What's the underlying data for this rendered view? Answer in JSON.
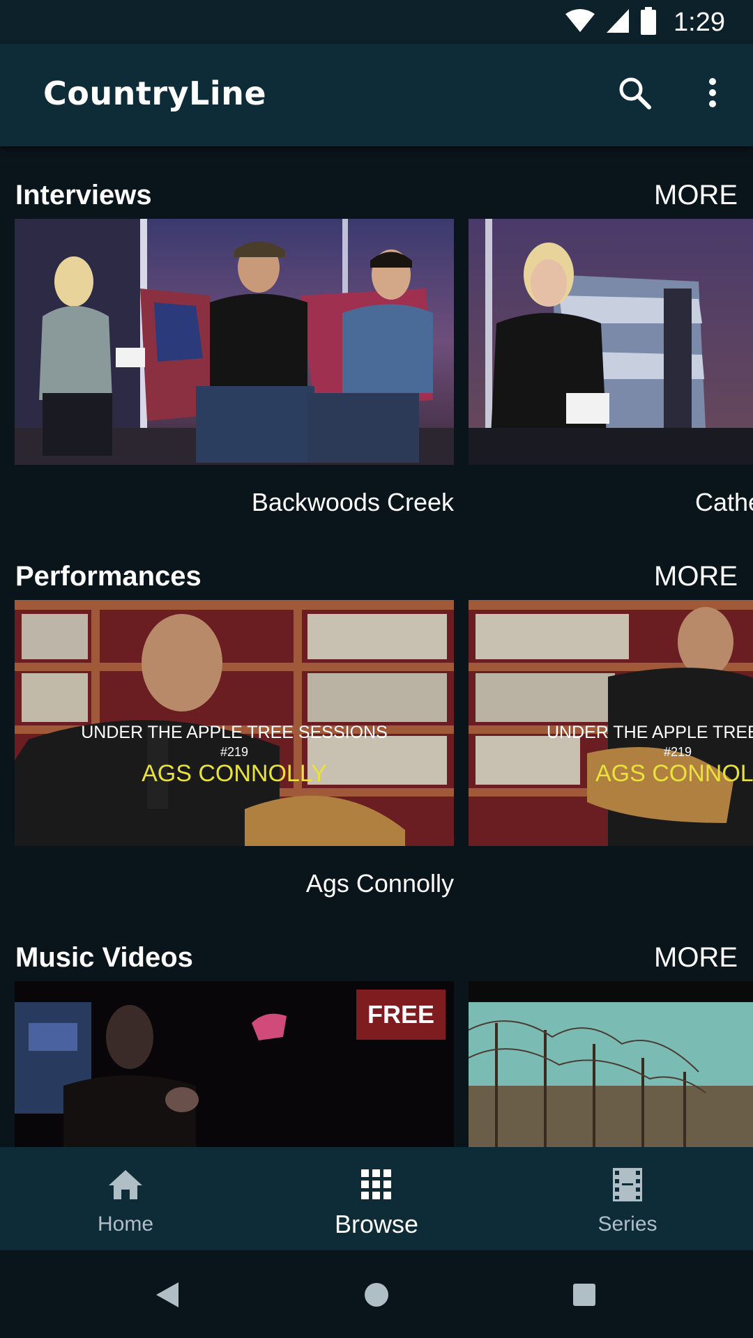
{
  "status_bar": {
    "time": "1:29"
  },
  "app_bar": {
    "title": "CountryLine",
    "search_icon": "search-icon",
    "menu_icon": "more-vert-icon"
  },
  "sections": [
    {
      "title": "Interviews",
      "more_label": "MORE",
      "cards": [
        {
          "title": "Backwoods Creek"
        },
        {
          "title": "Cathe"
        }
      ]
    },
    {
      "title": "Performances",
      "more_label": "MORE",
      "cards": [
        {
          "title": "Ags Connolly",
          "overlay_line1": "UNDER THE APPLE TREE SESSIONS",
          "overlay_line2": "#219",
          "overlay_line3": "AGS CONNOLLY"
        },
        {
          "title": "",
          "overlay_line1": "UNDER THE APPLE TREE S",
          "overlay_line2": "#219",
          "overlay_line3": "AGS CONNOL"
        }
      ]
    },
    {
      "title": "Music Videos",
      "more_label": "MORE",
      "cards": [
        {
          "title": "",
          "badge": "FREE"
        },
        {
          "title": ""
        }
      ]
    }
  ],
  "bottom_nav": {
    "items": [
      {
        "label": "Home",
        "icon": "home-icon",
        "active": false
      },
      {
        "label": "Browse",
        "icon": "grid-icon",
        "active": true
      },
      {
        "label": "Series",
        "icon": "film-icon",
        "active": false
      }
    ]
  },
  "colors": {
    "background": "#0a151b",
    "app_bar": "#0e2c38",
    "status_bar": "#0c2129",
    "badge": "#7e1c1f",
    "overlay_yellow": "#e8e23a"
  }
}
